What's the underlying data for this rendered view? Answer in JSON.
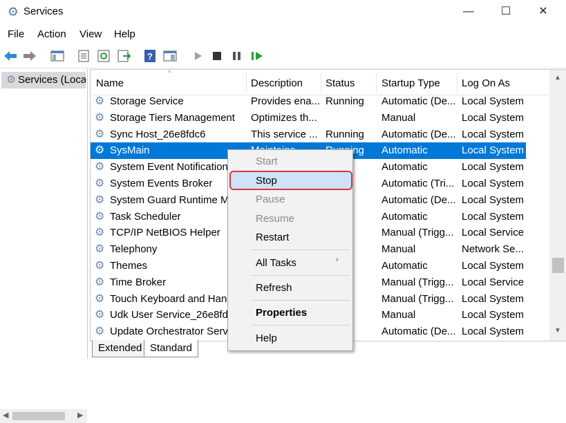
{
  "window": {
    "title": "Services",
    "icon": "gear-icon"
  },
  "menu": [
    "File",
    "Action",
    "View",
    "Help"
  ],
  "tree": {
    "root": "Services (Local"
  },
  "columns": [
    "Name",
    "Description",
    "Status",
    "Startup Type",
    "Log On As"
  ],
  "rows": [
    [
      "Storage Service",
      "Provides ena...",
      "Running",
      "Automatic (De...",
      "Local System"
    ],
    [
      "Storage Tiers Management",
      "Optimizes th...",
      "",
      "Manual",
      "Local System"
    ],
    [
      "Sync Host_26e8fdc6",
      "This service ...",
      "Running",
      "Automatic (De...",
      "Local System"
    ],
    [
      "SysMain",
      "Maintains ...",
      "Running",
      "Automatic",
      "Local System"
    ],
    [
      "System Event Notification",
      "",
      "ng",
      "Automatic",
      "Local System"
    ],
    [
      "System Events Broker",
      "",
      "ng",
      "Automatic (Tri...",
      "Local System"
    ],
    [
      "System Guard Runtime Mo",
      "",
      "ng",
      "Automatic (De...",
      "Local System"
    ],
    [
      "Task Scheduler",
      "",
      "ng",
      "Automatic",
      "Local System"
    ],
    [
      "TCP/IP NetBIOS Helper",
      "",
      "ng",
      "Manual (Trigg...",
      "Local Service"
    ],
    [
      "Telephony",
      "",
      "",
      "Manual",
      "Network Se..."
    ],
    [
      "Themes",
      "",
      "ng",
      "Automatic",
      "Local System"
    ],
    [
      "Time Broker",
      "",
      "ng",
      "Manual (Trigg...",
      "Local Service"
    ],
    [
      "Touch Keyboard and Hanc",
      "",
      "ng",
      "Manual (Trigg...",
      "Local System"
    ],
    [
      "Udk User Service_26e8fdc6",
      "",
      "",
      "Manual",
      "Local System"
    ],
    [
      "Update Orchestrator Servi",
      "",
      "ng",
      "Automatic (De...",
      "Local System"
    ]
  ],
  "selected_row": 3,
  "context_menu": {
    "start": "Start",
    "stop": "Stop",
    "pause": "Pause",
    "resume": "Resume",
    "restart": "Restart",
    "all_tasks": "All Tasks",
    "refresh": "Refresh",
    "properties": "Properties",
    "help": "Help"
  },
  "tabs": [
    "Extended",
    "Standard"
  ],
  "colors": {
    "selection": "#0078d7",
    "highlight_border": "#d9363e"
  }
}
